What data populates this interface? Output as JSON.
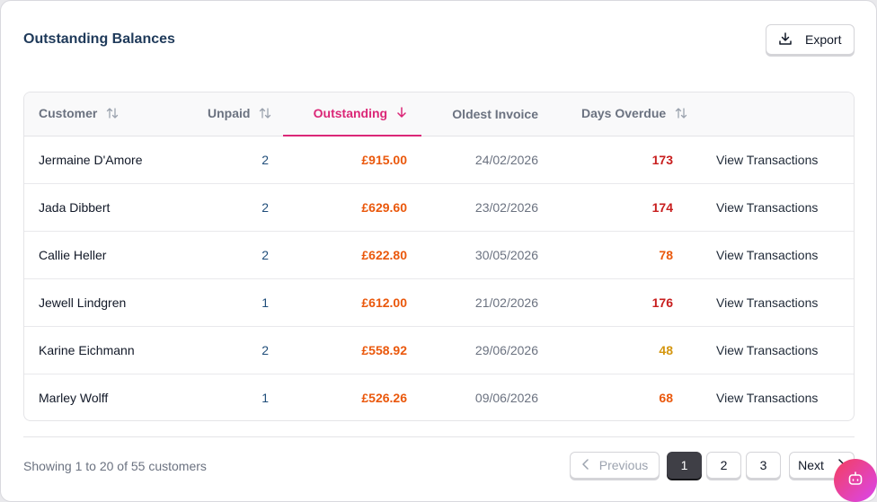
{
  "title": "Outstanding Balances",
  "export_label": "Export",
  "columns": [
    "Customer",
    "Unpaid",
    "Outstanding",
    "Oldest Invoice",
    "Days Overdue"
  ],
  "rows": [
    {
      "name": "Jermaine D'Amore",
      "unpaid": "2",
      "outstanding": "£915.00",
      "oldest": "24/02/2026",
      "days": "173",
      "action": "View Transactions"
    },
    {
      "name": "Jada Dibbert",
      "unpaid": "2",
      "outstanding": "£629.60",
      "oldest": "23/02/2026",
      "days": "174",
      "action": "View Transactions"
    },
    {
      "name": "Callie Heller",
      "unpaid": "2",
      "outstanding": "£622.80",
      "oldest": "30/05/2026",
      "days": "78",
      "action": "View Transactions"
    },
    {
      "name": "Jewell Lindgren",
      "unpaid": "1",
      "outstanding": "£612.00",
      "oldest": "21/02/2026",
      "days": "176",
      "action": "View Transactions"
    },
    {
      "name": "Karine Eichmann",
      "unpaid": "2",
      "outstanding": "£558.92",
      "oldest": "29/06/2026",
      "days": "48",
      "action": "View Transactions"
    },
    {
      "name": "Marley Wolff",
      "unpaid": "1",
      "outstanding": "£526.26",
      "oldest": "09/06/2026",
      "days": "68",
      "action": "View Transactions"
    }
  ],
  "pagination": {
    "showing": "Showing 1 to 20 of 55 customers",
    "previous": "Previous",
    "pages": [
      "1",
      "2",
      "3"
    ],
    "next": "Next"
  },
  "colors": {
    "accent": "#db2777",
    "amount": "#ea580c",
    "days_critical": "#c81e1e",
    "days_high": "#ea580c",
    "days_medium": "#d4960f"
  },
  "icons": [
    "download-icon",
    "sort-icon",
    "arrow-down-icon",
    "chevron-left-icon",
    "chevron-right-icon",
    "bot-icon"
  ]
}
